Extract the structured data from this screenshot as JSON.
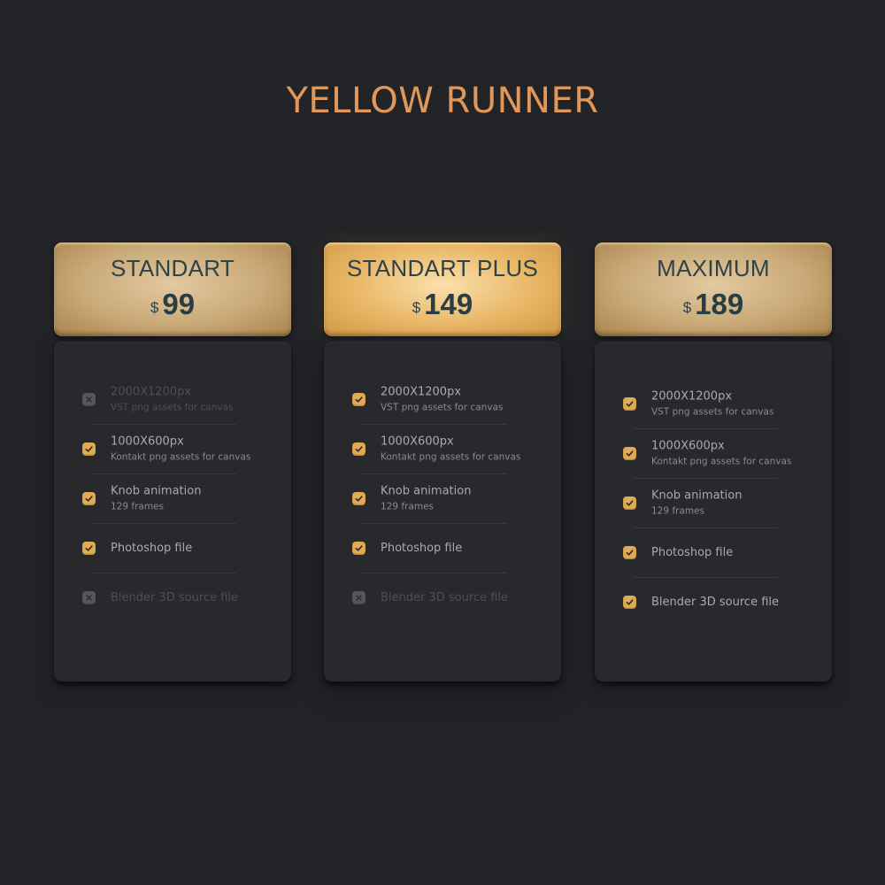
{
  "page": {
    "title": "YELLOW RUNNER",
    "accent_color": "#e0975a",
    "check_color": "#e0ab52",
    "disabled_color": "#55575b"
  },
  "plans": [
    {
      "name": "STANDART",
      "currency": "$",
      "price": "99",
      "highlighted": false,
      "features": [
        {
          "title": "2000X1200px",
          "subtitle": "VST png assets for canvas",
          "included": false
        },
        {
          "title": "1000X600px",
          "subtitle": "Kontakt png assets for canvas",
          "included": true
        },
        {
          "title": "Knob animation",
          "subtitle": "129 frames",
          "included": true
        },
        {
          "title": "Photoshop file",
          "subtitle": "",
          "included": true
        },
        {
          "title": "Blender 3D source file",
          "subtitle": "",
          "included": false
        }
      ]
    },
    {
      "name": "STANDART PLUS",
      "currency": "$",
      "price": "149",
      "highlighted": true,
      "features": [
        {
          "title": "2000X1200px",
          "subtitle": "VST png assets for canvas",
          "included": true
        },
        {
          "title": "1000X600px",
          "subtitle": "Kontakt png assets for canvas",
          "included": true
        },
        {
          "title": "Knob animation",
          "subtitle": "129 frames",
          "included": true
        },
        {
          "title": "Photoshop file",
          "subtitle": "",
          "included": true
        },
        {
          "title": "Blender 3D source file",
          "subtitle": "",
          "included": false
        }
      ]
    },
    {
      "name": "MAXIMUM",
      "currency": "$",
      "price": "189",
      "highlighted": false,
      "features": [
        {
          "title": "2000X1200px",
          "subtitle": "VST png assets for canvas",
          "included": true
        },
        {
          "title": "1000X600px",
          "subtitle": "Kontakt png assets for canvas",
          "included": true
        },
        {
          "title": "Knob animation",
          "subtitle": "129 frames",
          "included": true
        },
        {
          "title": "Photoshop file",
          "subtitle": "",
          "included": true
        },
        {
          "title": "Blender 3D source file",
          "subtitle": "",
          "included": true
        }
      ]
    }
  ]
}
